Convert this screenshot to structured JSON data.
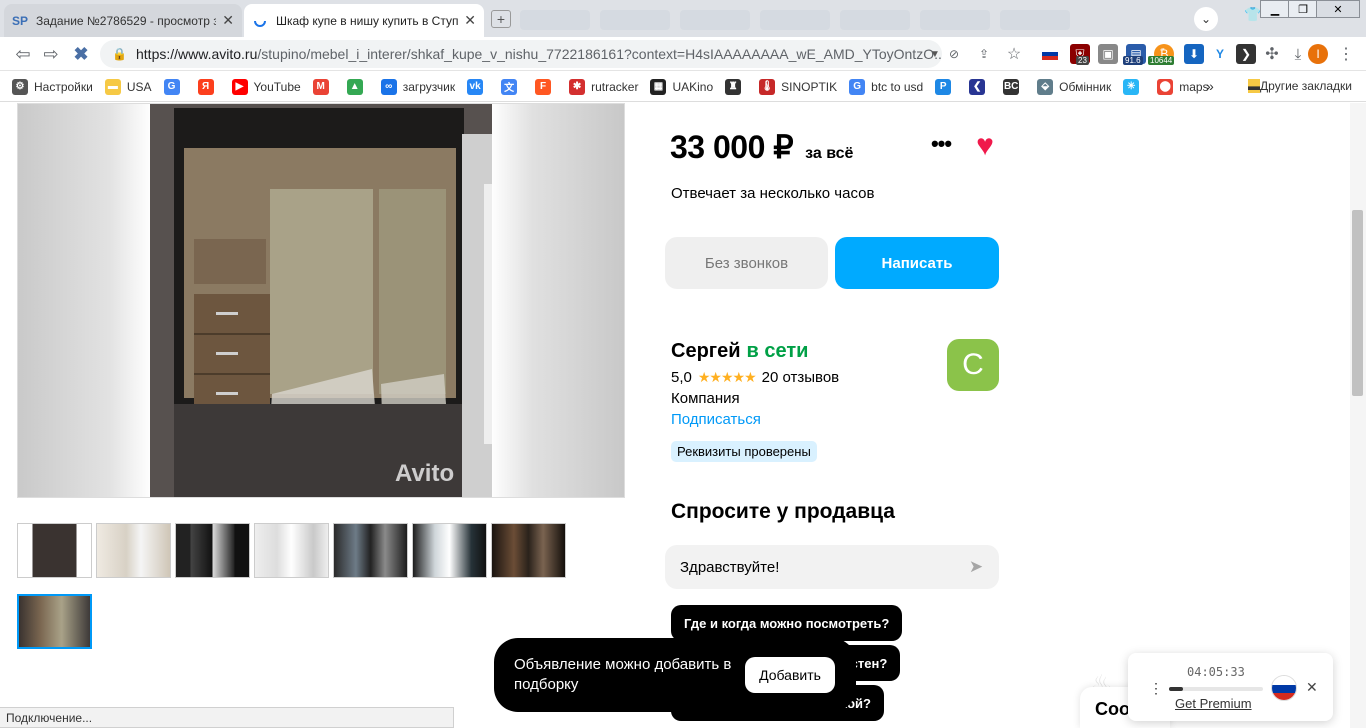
{
  "browser": {
    "tabs": [
      {
        "favicon": "SP",
        "title": "Задание №2786529 - просмотр з"
      },
      {
        "favicon": "loading-spinner-icon",
        "title": "Шкаф купе в нишу купить в Ступ"
      }
    ],
    "new_tab": "+",
    "close_glyph": "✕",
    "address": {
      "host": "https://www.avito.ru",
      "path": "/stupino/mebel_i_interer/shkaf_kupe_v_nishu_7722186161?context=H4sIAAAAAAAA_wE_AMD_YToyOntzO..."
    },
    "extension_badges": {
      "ext_23": "23",
      "ext_916": "91.6",
      "ext_10644": "10644",
      "profile_initial": "I"
    },
    "bookmarks": [
      {
        "label": "Настройки",
        "icon": "gear-icon",
        "color": "#555555"
      },
      {
        "label": "USA",
        "icon": "folder-icon",
        "color": "#f6c945"
      },
      {
        "label": "",
        "icon": "google-icon",
        "color": "#4285f4"
      },
      {
        "label": "",
        "icon": "yandex-icon",
        "color": "#fc3f1d"
      },
      {
        "label": "YouTube",
        "icon": "youtube-icon",
        "color": "#ff0000"
      },
      {
        "label": "",
        "icon": "gmail-icon",
        "color": "#ea4335"
      },
      {
        "label": "",
        "icon": "drive-icon",
        "color": "#34a853"
      },
      {
        "label": "загрузчик",
        "icon": "loader-icon",
        "color": "#1a73e8"
      },
      {
        "label": "",
        "icon": "vk-icon",
        "color": "#2787f5"
      },
      {
        "label": "",
        "icon": "translate-icon",
        "color": "#4285f4"
      },
      {
        "label": "",
        "icon": "f-icon",
        "color": "#ff5722"
      },
      {
        "label": "rutracker",
        "icon": "rutracker-icon",
        "color": "#d32f2f"
      },
      {
        "label": "UAKino",
        "icon": "uakino-icon",
        "color": "#222222"
      },
      {
        "label": "",
        "icon": "figure-icon",
        "color": "#333333"
      },
      {
        "label": "SINOPTIK",
        "icon": "thermometer-icon",
        "color": "#c62828"
      },
      {
        "label": "btc to usd",
        "icon": "google-icon",
        "color": "#4285f4"
      },
      {
        "label": "",
        "icon": "p-icon",
        "color": "#1e88e5"
      },
      {
        "label": "",
        "icon": "arrow-icon",
        "color": "#283593"
      },
      {
        "label": "",
        "icon": "bc-icon",
        "color": "#333333"
      },
      {
        "label": "Обмінник",
        "icon": "exchange-icon",
        "color": "#607d8b"
      },
      {
        "label": "",
        "icon": "star-burst-icon",
        "color": "#29b6f6"
      },
      {
        "label": "maps",
        "icon": "maps-pin-icon",
        "color": "#ea4335"
      }
    ],
    "bookmarks_overflow": "»",
    "other_bookmarks": "Другие закладки",
    "status": "Подключение..."
  },
  "listing": {
    "price": "33 000 ₽",
    "price_suffix": "за всё",
    "response_time": "Отвечает за несколько часов",
    "no_calls_label": "Без звонков",
    "write_label": "Написать",
    "photo_watermark": "Avito",
    "seller": {
      "name": "Сергей",
      "online": "в сети",
      "rating": "5,0",
      "reviews": "20 отзывов",
      "type": "Компания",
      "subscribe": "Подписаться",
      "verified": "Реквизиты проверены",
      "avatar_letter": "С",
      "avatar_color": "#8bc34a",
      "stars": 5
    },
    "ask": {
      "title": "Спросите у продавца",
      "input_value": "Здравствуйте!",
      "questions": [
        "Где и когда можно посмотреть?",
        "местен?",
        "кой?"
      ]
    }
  },
  "toast": {
    "text": "Объявление можно добавить в подборку",
    "button": "Добавить"
  },
  "chat_stub": "Соо",
  "vpn_widget": {
    "timer": "04:05:33",
    "premium": "Get Premium",
    "progress": 0.15,
    "close": "✕",
    "menu": "⋮"
  },
  "colors": {
    "accent_blue": "#00aaff",
    "link_blue": "#0099f7",
    "online_green": "#00a046",
    "favorite_red": "#f0194b"
  }
}
